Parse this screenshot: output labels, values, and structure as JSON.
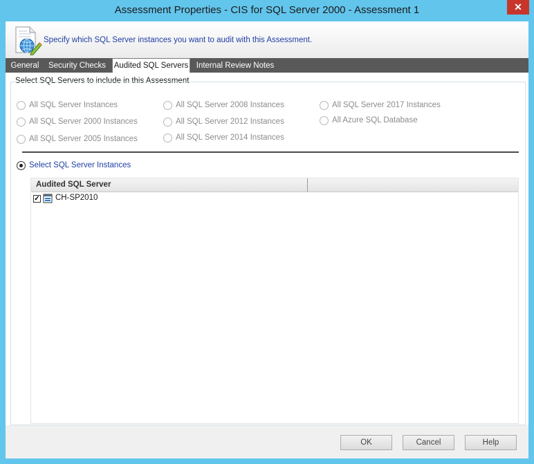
{
  "window": {
    "title": "Assessment Properties - CIS for SQL Server 2000 - Assessment 1",
    "close_glyph": "✕"
  },
  "header": {
    "icon": "document-globe-pencil-icon",
    "text": "Specify which SQL Server instances you want to audit with this Assessment."
  },
  "tabs": [
    {
      "label": "General",
      "active": false
    },
    {
      "label": "Security Checks",
      "active": false
    },
    {
      "label": "Audited SQL Servers",
      "active": true
    },
    {
      "label": "Internal Review Notes",
      "active": false
    }
  ],
  "group": {
    "caption": "Select SQL Servers to include in this Assessment",
    "options": [
      {
        "label": "All SQL Server Instances",
        "checked": false,
        "enabled": false
      },
      {
        "label": "All SQL Server 2000 Instances",
        "checked": false,
        "enabled": false
      },
      {
        "label": "All SQL Server 2005 Instances",
        "checked": false,
        "enabled": false
      },
      {
        "label": "All SQL Server 2008 Instances",
        "checked": false,
        "enabled": false
      },
      {
        "label": "All SQL Server 2012 Instances",
        "checked": false,
        "enabled": false
      },
      {
        "label": "All SQL Server 2014 Instances",
        "checked": false,
        "enabled": false
      },
      {
        "label": "All SQL Server 2017 Instances",
        "checked": false,
        "enabled": false
      },
      {
        "label": "All Azure SQL Database",
        "checked": false,
        "enabled": false
      }
    ],
    "select_option": {
      "label": "Select SQL Server Instances",
      "checked": true
    }
  },
  "grid": {
    "columns": [
      "Audited SQL Server",
      ""
    ],
    "rows": [
      {
        "name": "CH-SP2010",
        "checked": true,
        "icon": "sql-server-icon"
      }
    ]
  },
  "buttons": {
    "ok": "OK",
    "cancel": "Cancel",
    "help": "Help"
  },
  "colors": {
    "window_frame": "#62c5ec",
    "close_button": "#c7352b",
    "tab_strip": "#595959",
    "label_blue": "#1f3ea5"
  }
}
